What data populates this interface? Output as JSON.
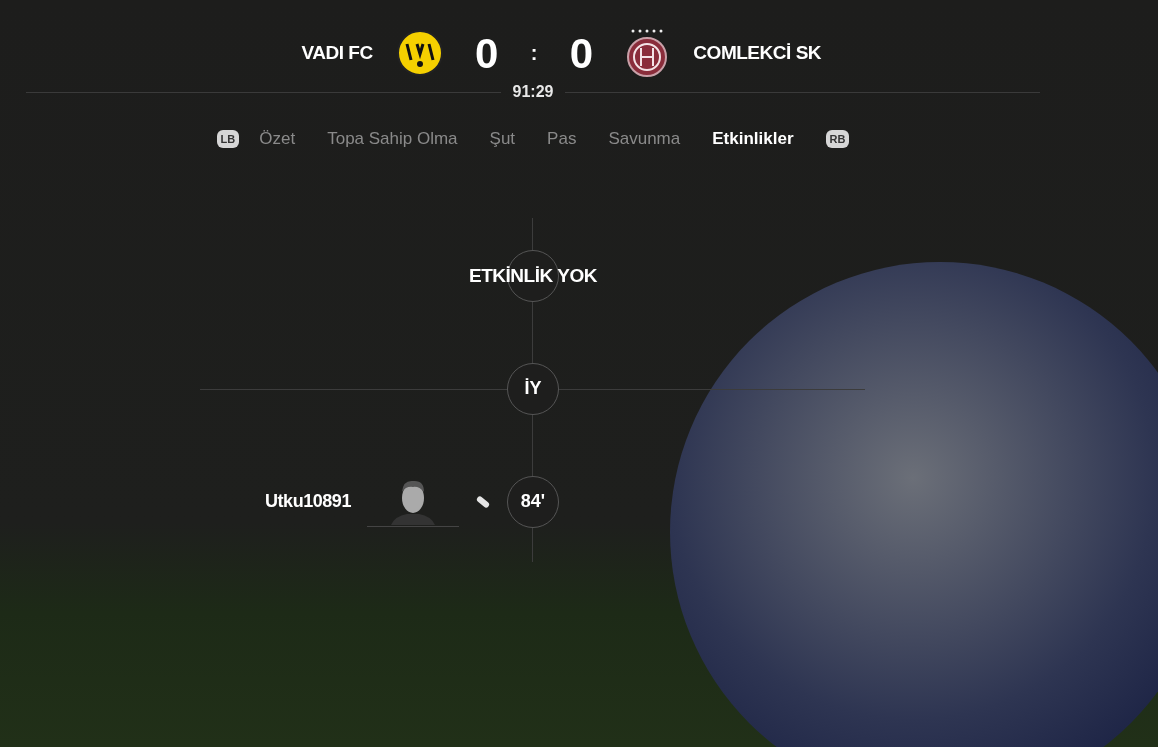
{
  "match": {
    "home": {
      "name": "VADI FC"
    },
    "home_score": "0",
    "separator": ":",
    "away_score": "0",
    "away": {
      "name": "COMLEKCİ SK"
    },
    "clock": "91:29"
  },
  "tabs": {
    "left_button": "LB",
    "right_button": "RB",
    "items": [
      {
        "label": "Özet",
        "selected": false
      },
      {
        "label": "Topa Sahip Olma",
        "selected": false
      },
      {
        "label": "Şut",
        "selected": false
      },
      {
        "label": "Pas",
        "selected": false
      },
      {
        "label": "Savunma",
        "selected": false
      },
      {
        "label": "Etkinlikler",
        "selected": true
      }
    ]
  },
  "timeline": [
    {
      "kind": "empty",
      "text": "ETKİNLİK YOK"
    },
    {
      "kind": "period",
      "text": "İY"
    },
    {
      "kind": "event",
      "home_team": true,
      "minute": "84'",
      "player": "Utku10891"
    }
  ]
}
